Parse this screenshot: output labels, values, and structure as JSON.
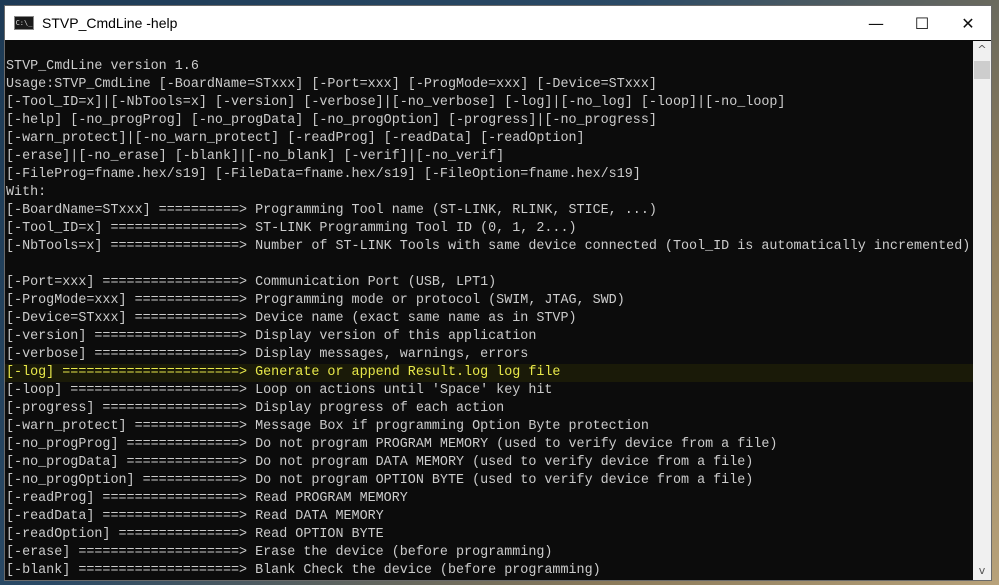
{
  "window": {
    "title": "STVP_CmdLine -help",
    "icon_text": "C:\\_"
  },
  "controls": {
    "minimize": "—",
    "maximize": "☐",
    "close": "✕"
  },
  "console": {
    "lines": [
      "STVP_CmdLine version 1.6",
      "Usage:STVP_CmdLine [-BoardName=STxxx] [-Port=xxx] [-ProgMode=xxx] [-Device=STxxx]",
      "[-Tool_ID=x]|[-NbTools=x] [-version] [-verbose]|[-no_verbose] [-log]|[-no_log] [-loop]|[-no_loop]",
      "[-help] [-no_progProg] [-no_progData] [-no_progOption] [-progress]|[-no_progress]",
      "[-warn_protect]|[-no_warn_protect] [-readProg] [-readData] [-readOption]",
      "[-erase]|[-no_erase] [-blank]|[-no_blank] [-verif]|[-no_verif]",
      "[-FileProg=fname.hex/s19] [-FileData=fname.hex/s19] [-FileOption=fname.hex/s19]",
      "With:",
      "[-BoardName=STxxx] ==========> Programming Tool name (ST-LINK, RLINK, STICE, ...)",
      "[-Tool_ID=x] ================> ST-LINK Programming Tool ID (0, 1, 2...)",
      "[-NbTools=x] ================> Number of ST-LINK Tools with same device connected (Tool_ID is automatically incremented)",
      "",
      "[-Port=xxx] =================> Communication Port (USB, LPT1)",
      "[-ProgMode=xxx] =============> Programming mode or protocol (SWIM, JTAG, SWD)",
      "[-Device=STxxx] =============> Device name (exact same name as in STVP)",
      "[-version] ==================> Display version of this application",
      "[-verbose] ==================> Display messages, warnings, errors",
      "[-log] ======================> Generate or append Result.log log file",
      "[-loop] =====================> Loop on actions until 'Space' key hit",
      "[-progress] =================> Display progress of each action",
      "[-warn_protect] =============> Message Box if programming Option Byte protection",
      "[-no_progProg] ==============> Do not program PROGRAM MEMORY (used to verify device from a file)",
      "[-no_progData] ==============> Do not program DATA MEMORY (used to verify device from a file)",
      "[-no_progOption] ============> Do not program OPTION BYTE (used to verify device from a file)",
      "[-readProg] =================> Read PROGRAM MEMORY",
      "[-readData] =================> Read DATA MEMORY",
      "[-readOption] ===============> Read OPTION BYTE",
      "[-erase] ====================> Erase the device (before programming)",
      "[-blank] ====================> Blank Check the device (before programming)"
    ],
    "highlighted_line": 17,
    "highlight_color": "#e8e84a"
  },
  "scrollbar": {
    "up": "^",
    "down": "v",
    "position": 0.0
  }
}
